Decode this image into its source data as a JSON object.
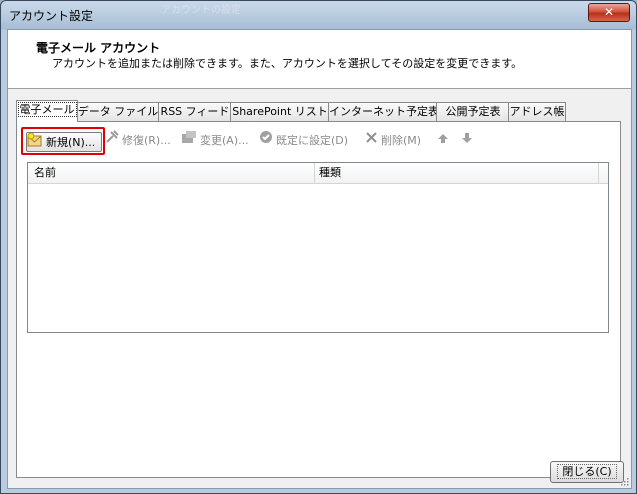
{
  "window": {
    "title": "アカウント設定",
    "title_ghost": "アカウントの設定",
    "close_glyph": "✕"
  },
  "header": {
    "title": "電子メール アカウント",
    "description": "アカウントを追加または削除できます。また、アカウントを選択してその設定を変更できます。"
  },
  "tabs": [
    {
      "label": "電子メール",
      "active": true
    },
    {
      "label": "データ ファイル"
    },
    {
      "label": "RSS フィード"
    },
    {
      "label": "SharePoint リスト"
    },
    {
      "label": "インターネット予定表"
    },
    {
      "label": "公開予定表"
    },
    {
      "label": "アドレス帳"
    }
  ],
  "toolbar": {
    "new_label": "新規(N)...",
    "repair_label": "修復(R)...",
    "change_label": "変更(A)...",
    "default_label": "既定に設定(D)",
    "delete_label": "削除(M)"
  },
  "list": {
    "columns": [
      "名前",
      "種類"
    ]
  },
  "footer": {
    "close_label": "閉じる(C)"
  },
  "colors": {
    "highlight": "#e00000",
    "title_bg": "#a8bed6",
    "close_button": "#c9432b"
  }
}
